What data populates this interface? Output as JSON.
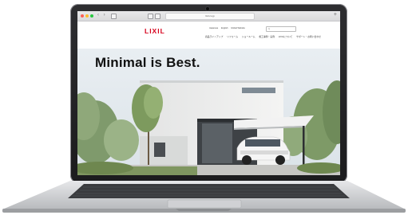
{
  "browser": {
    "url": "lixil.co.jp",
    "nav_arrows": "‹ ›"
  },
  "site": {
    "logo": "LIXIL",
    "utility_links": [
      "Japanese",
      "English",
      "Global Website"
    ],
    "search_placeholder": "Q",
    "nav_items": [
      "商品ラインアップ",
      "リフォーム",
      "ショールーム",
      "施工事例・実例",
      "LIXILについて",
      "サポート・お問い合わせ"
    ]
  },
  "hero": {
    "title": "Minimal is Best."
  },
  "colors": {
    "brand": "#d6001c",
    "laptop_body": "#2e2e31",
    "browser_chrome": "#e3e3e5"
  }
}
